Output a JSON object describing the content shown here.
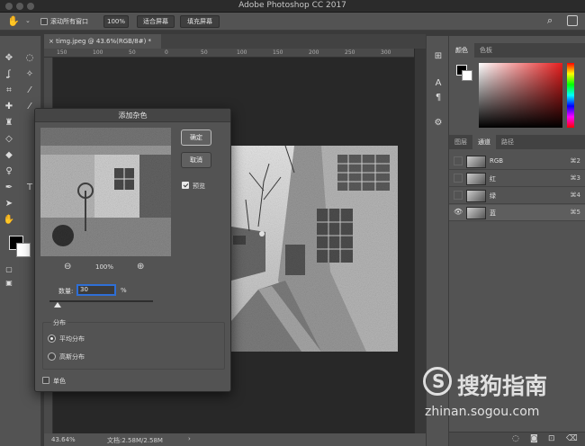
{
  "window": {
    "title": "Adobe Photoshop CC 2017",
    "traffic_colors": [
      "#555555",
      "#555555",
      "#555555"
    ]
  },
  "options_bar": {
    "scroll_all_label": "滚动所有窗口",
    "zoom_100": "100%",
    "fit_screen": "适合屏幕",
    "fill_screen": "填充屏幕"
  },
  "document": {
    "tab_title": "timg.jpeg @ 43.6%(RGB/8#) *",
    "ruler_ticks": [
      "150",
      "100",
      "50",
      "0",
      "50",
      "100",
      "150",
      "200",
      "250",
      "300"
    ]
  },
  "status_bar": {
    "zoom": "43.64%",
    "doc_info": "文档:2.58M/2.58M"
  },
  "panels": {
    "color_tabs": [
      "颜色",
      "色板"
    ],
    "layer_tabs": [
      "图层",
      "通道",
      "路径"
    ],
    "channels": [
      {
        "name": "RGB",
        "shortcut": "⌘2"
      },
      {
        "name": "红",
        "shortcut": "⌘3"
      },
      {
        "name": "绿",
        "shortcut": "⌘4"
      },
      {
        "name": "蓝",
        "shortcut": "⌘5"
      }
    ]
  },
  "dialog": {
    "title": "添加杂色",
    "ok": "确定",
    "cancel": "取消",
    "preview_label": "预览",
    "preview_checked": true,
    "zoom": "100%",
    "amount_label": "数量:",
    "amount_value": "30",
    "amount_unit": "%",
    "slider_fraction": 0.075,
    "distribution_label": "分布",
    "uniform_label": "平均分布",
    "gaussian_label": "高斯分布",
    "selected_distribution": "uniform",
    "mono_label": "单色",
    "mono_checked": false
  },
  "watermark": {
    "brand": "搜狗指南",
    "url": "zhinan.sogou.com"
  },
  "colors": {
    "accent": "#2f6fd6",
    "panel_bg": "#535353",
    "canvas_bg": "#282828"
  }
}
